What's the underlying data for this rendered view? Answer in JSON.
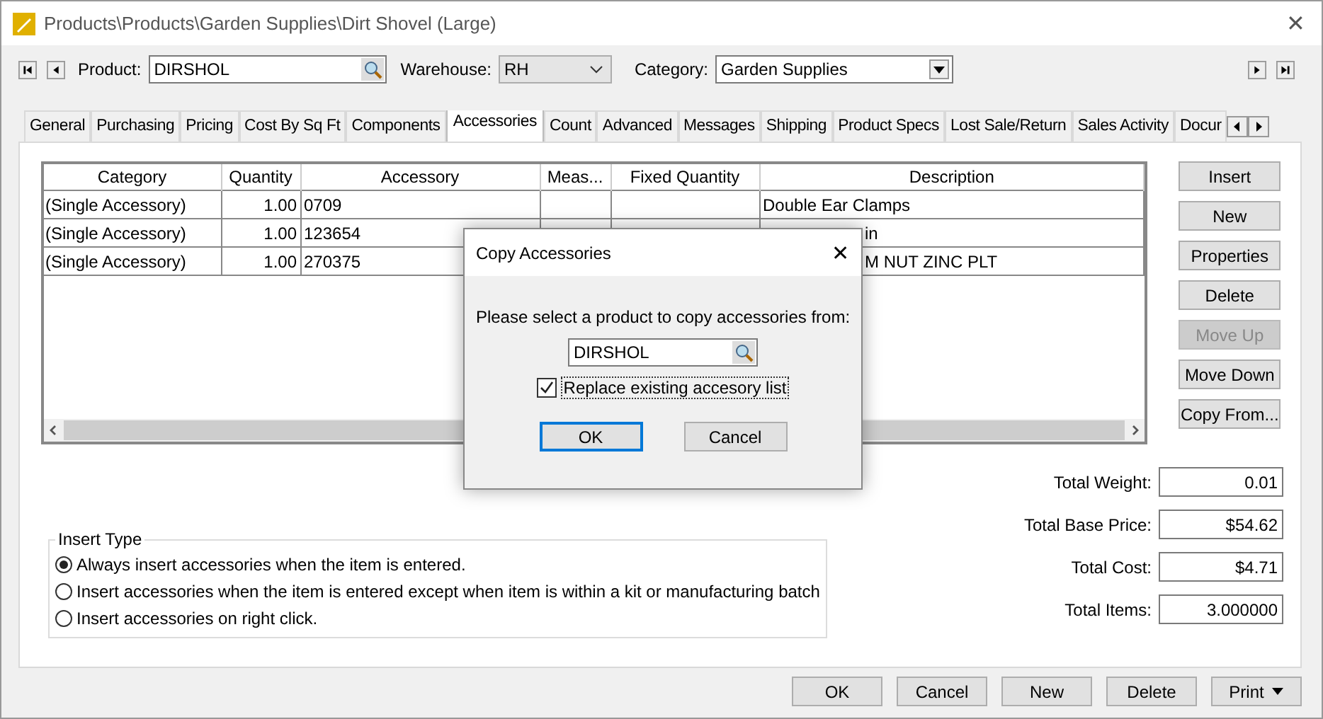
{
  "window": {
    "title": "Products\\Products\\Garden Supplies\\Dirt Shovel (Large)",
    "close": "✕"
  },
  "toolbar": {
    "product_label": "Product:",
    "product": "DIRSHOL",
    "warehouse_label": "Warehouse:",
    "warehouse": "RH",
    "category_label": "Category:",
    "category": "Garden Supplies"
  },
  "tabs": [
    {
      "label": "General",
      "selected": false
    },
    {
      "label": "Purchasing",
      "selected": false
    },
    {
      "label": "Pricing",
      "selected": false
    },
    {
      "label": "Cost By Sq Ft",
      "selected": false
    },
    {
      "label": "Components",
      "selected": false
    },
    {
      "label": "Accessories",
      "selected": true
    },
    {
      "label": "Count",
      "selected": false
    },
    {
      "label": "Advanced",
      "selected": false
    },
    {
      "label": "Messages",
      "selected": false
    },
    {
      "label": "Shipping",
      "selected": false
    },
    {
      "label": "Product Specs",
      "selected": false
    },
    {
      "label": "Lost Sale/Return",
      "selected": false
    },
    {
      "label": "Sales Activity",
      "selected": false
    },
    {
      "label": "Docur",
      "selected": false
    }
  ],
  "table": {
    "columns": [
      "Category",
      "Quantity",
      "Accessory",
      "Meas...",
      "Fixed Quantity",
      "Description"
    ],
    "rows": [
      {
        "category": "(Single Accessory)",
        "quantity": "1.00",
        "accessory": "0709",
        "description": "Double Ear Clamps",
        "covered_left": false
      },
      {
        "category": "(Single Accessory)",
        "quantity": "1.00",
        "accessory": "123654",
        "description": "in",
        "covered_left": true
      },
      {
        "category": "(Single Accessory)",
        "quantity": "1.00",
        "accessory": "270375",
        "description": "M NUT ZINC PLT",
        "covered_left": true
      }
    ]
  },
  "side_buttons": [
    {
      "label": "Insert",
      "disabled": false
    },
    {
      "label": "New",
      "disabled": false
    },
    {
      "label": "Properties",
      "disabled": false
    },
    {
      "label": "Delete",
      "disabled": false
    },
    {
      "label": "Move Up",
      "disabled": true
    },
    {
      "label": "Move Down",
      "disabled": false
    },
    {
      "label": "Copy From...",
      "disabled": false
    }
  ],
  "totals": [
    {
      "label": "Total Weight:",
      "value": "0.01"
    },
    {
      "label": "Total Base Price:",
      "value": "$54.62"
    },
    {
      "label": "Total Cost:",
      "value": "$4.71"
    },
    {
      "label": "Total Items:",
      "value": "3.000000"
    }
  ],
  "insert_type": {
    "title": "Insert Type",
    "options": [
      {
        "label": "Always insert accessories when the item is entered.",
        "selected": true
      },
      {
        "label": "Insert accessories when the item is entered except when item is within a kit or manufacturing batch",
        "selected": false
      },
      {
        "label": "Insert accessories on right click.",
        "selected": false
      }
    ]
  },
  "buttons": [
    "OK",
    "Cancel",
    "New",
    "Delete",
    "Print"
  ],
  "dialog": {
    "title": "Copy Accessories",
    "close": "✕",
    "prompt": "Please select a product to copy accessories from:",
    "product": "DIRSHOL",
    "replace_label": "Replace existing accesory list",
    "replace_checked": true,
    "buttons": [
      "OK",
      "Cancel"
    ]
  }
}
